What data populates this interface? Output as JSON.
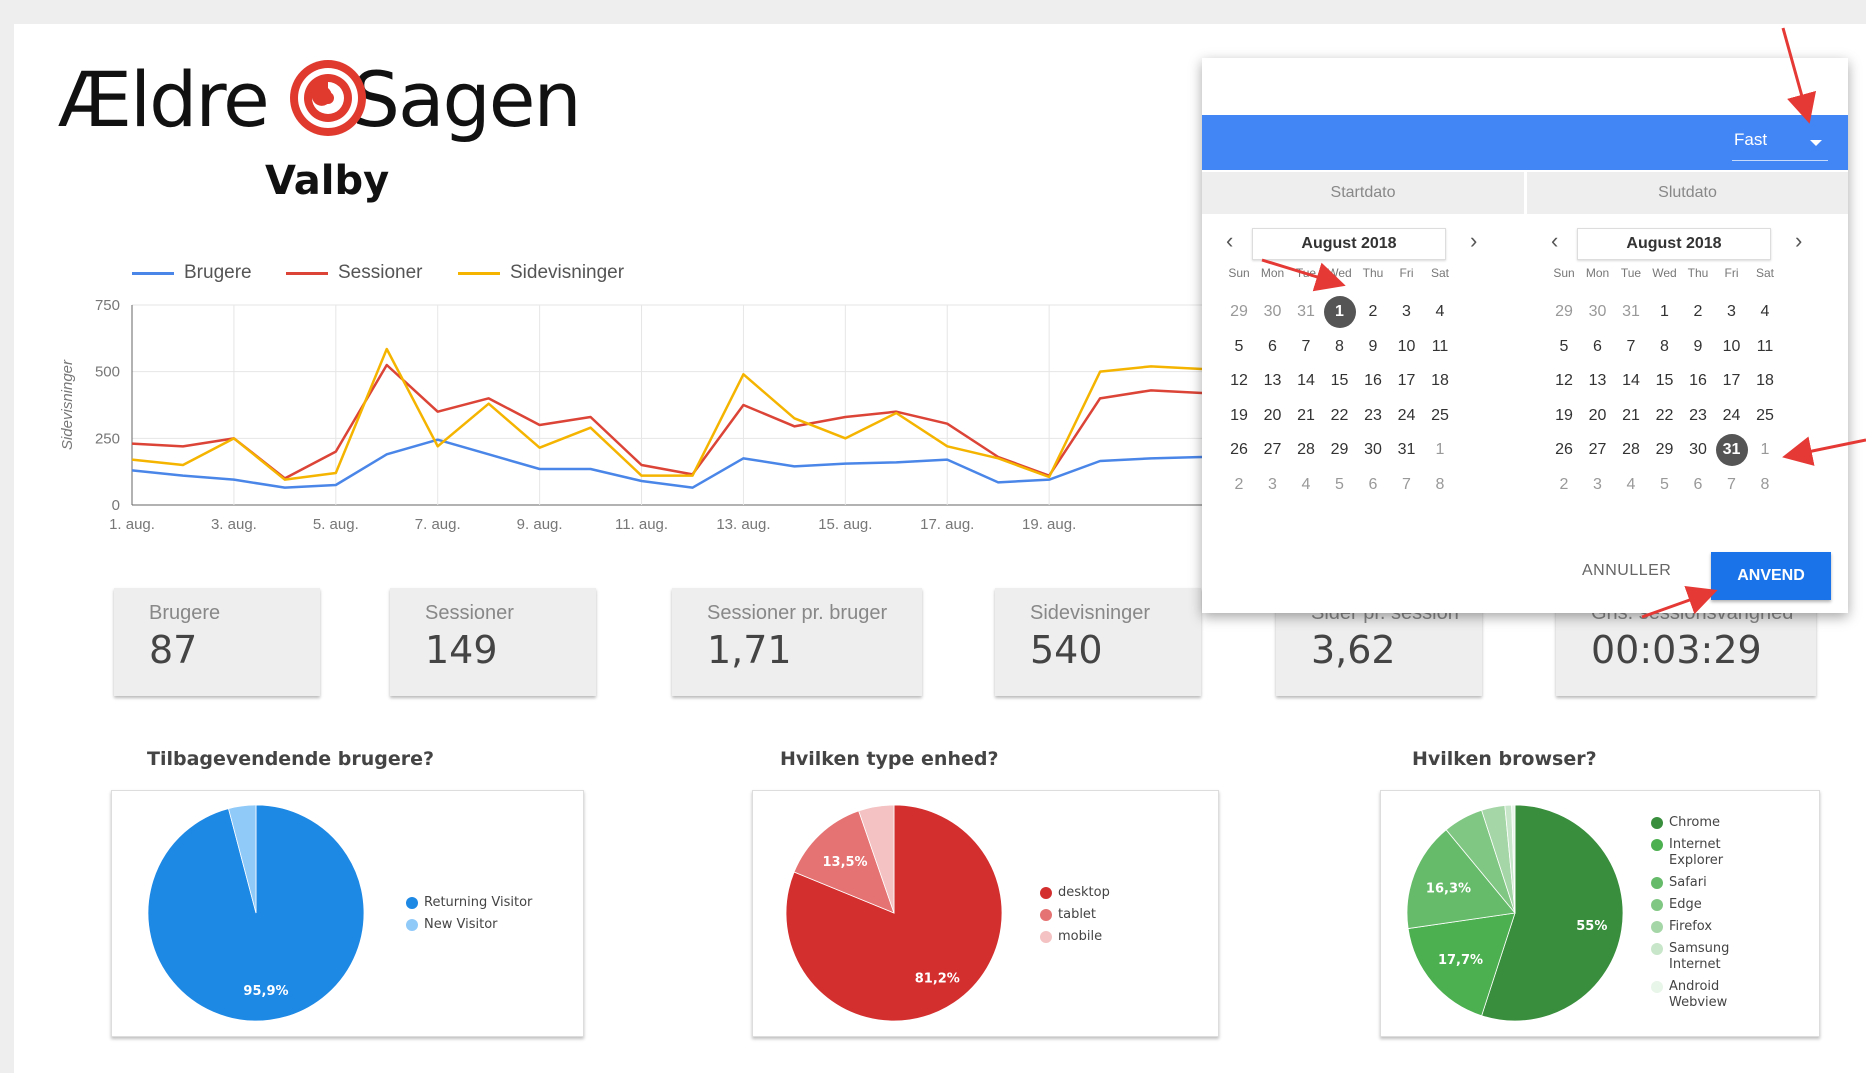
{
  "logo": {
    "part1": "Ældre",
    "part2": "Sagen",
    "subtitle": "Valby"
  },
  "chart_data": {
    "type": "line",
    "title": "",
    "ylabel": "Sidevisninger",
    "xlabel": "",
    "ylim": [
      0,
      750
    ],
    "yticks": [
      "0",
      "250",
      "500",
      "750"
    ],
    "xticklabels": [
      "1. aug.",
      "3. aug.",
      "5. aug.",
      "7. aug.",
      "9. aug.",
      "11. aug.",
      "13. aug.",
      "15. aug.",
      "17. aug.",
      "19. aug."
    ],
    "x": [
      1,
      2,
      3,
      4,
      5,
      6,
      7,
      8,
      9,
      10,
      11,
      12,
      13,
      14,
      15,
      16,
      17,
      18,
      19,
      20,
      21,
      22
    ],
    "series": [
      {
        "name": "Brugere",
        "color": "#4a86e8",
        "values": [
          130,
          110,
          95,
          65,
          75,
          190,
          245,
          190,
          135,
          135,
          90,
          65,
          175,
          145,
          155,
          160,
          170,
          85,
          95,
          165,
          175,
          180
        ]
      },
      {
        "name": "Sessioner",
        "color": "#db4437",
        "values": [
          230,
          220,
          250,
          100,
          200,
          525,
          350,
          400,
          300,
          330,
          150,
          115,
          375,
          295,
          330,
          350,
          305,
          180,
          110,
          400,
          430,
          420
        ]
      },
      {
        "name": "Sidevisninger",
        "color": "#f4b400",
        "values": [
          170,
          150,
          250,
          95,
          120,
          585,
          220,
          380,
          215,
          290,
          110,
          110,
          490,
          325,
          250,
          345,
          220,
          175,
          105,
          500,
          520,
          510
        ]
      }
    ],
    "legend": "top-left",
    "grid": true
  },
  "kpis": [
    {
      "label": "Brugere",
      "value": "87"
    },
    {
      "label": "Sessioner",
      "value": "149"
    },
    {
      "label": "Sessioner pr. bruger",
      "value": "1,71"
    },
    {
      "label": "Sidevisninger",
      "value": "540"
    },
    {
      "label": "Sider pr. session",
      "value": "3,62"
    },
    {
      "label": "Gns. sessionsvarighed",
      "value": "00:03:29"
    }
  ],
  "pies": [
    {
      "title": "Tilbagevendende brugere?",
      "slices": [
        {
          "name": "Returning Visitor",
          "value": 95.9,
          "label": "95,9%",
          "color": "#1e88e5"
        },
        {
          "name": "New Visitor",
          "value": 4.1,
          "label": "",
          "color": "#90caf9"
        }
      ]
    },
    {
      "title": "Hvilken type enhed?",
      "slices": [
        {
          "name": "desktop",
          "value": 81.2,
          "label": "81,2%",
          "color": "#d32f2f"
        },
        {
          "name": "tablet",
          "value": 13.5,
          "label": "13,5%",
          "color": "#e57373"
        },
        {
          "name": "mobile",
          "value": 5.3,
          "label": "",
          "color": "#f4c2c2"
        }
      ]
    },
    {
      "title": "Hvilken browser?",
      "slices": [
        {
          "name": "Chrome",
          "value": 55,
          "label": "55%",
          "color": "#388e3c"
        },
        {
          "name": "Internet Explorer",
          "value": 17.7,
          "label": "17,7%",
          "color": "#4caf50"
        },
        {
          "name": "Safari",
          "value": 16.3,
          "label": "16,3%",
          "color": "#66bb6a"
        },
        {
          "name": "Edge",
          "value": 6,
          "label": "",
          "color": "#81c784"
        },
        {
          "name": "Firefox",
          "value": 3.5,
          "label": "",
          "color": "#a5d6a7"
        },
        {
          "name": "Samsung Internet",
          "value": 1,
          "label": "",
          "color": "#c8e6c9"
        },
        {
          "name": "Android Webview",
          "value": 0.5,
          "label": "",
          "color": "#e8f5e9"
        }
      ]
    }
  ],
  "datepicker": {
    "mode": "Fast",
    "start_tab": "Startdato",
    "end_tab": "Slutdato",
    "start": {
      "month": "August 2018",
      "selected": "1"
    },
    "end": {
      "month": "August 2018",
      "selected": "31"
    },
    "weekdays": [
      "Sun",
      "Mon",
      "Tue",
      "Wed",
      "Thu",
      "Fri",
      "Sat"
    ],
    "weeks": [
      [
        "29",
        "30",
        "31",
        "1",
        "2",
        "3",
        "4"
      ],
      [
        "5",
        "6",
        "7",
        "8",
        "9",
        "10",
        "11"
      ],
      [
        "12",
        "13",
        "14",
        "15",
        "16",
        "17",
        "18"
      ],
      [
        "19",
        "20",
        "21",
        "22",
        "23",
        "24",
        "25"
      ],
      [
        "26",
        "27",
        "28",
        "29",
        "30",
        "31",
        "1"
      ],
      [
        "2",
        "3",
        "4",
        "5",
        "6",
        "7",
        "8"
      ]
    ],
    "cancel_label": "ANNULLER",
    "apply_label": "ANVEND"
  },
  "colors": {
    "accent": "#4285f4",
    "apply": "#1a73e8",
    "annotation": "#e53935"
  }
}
